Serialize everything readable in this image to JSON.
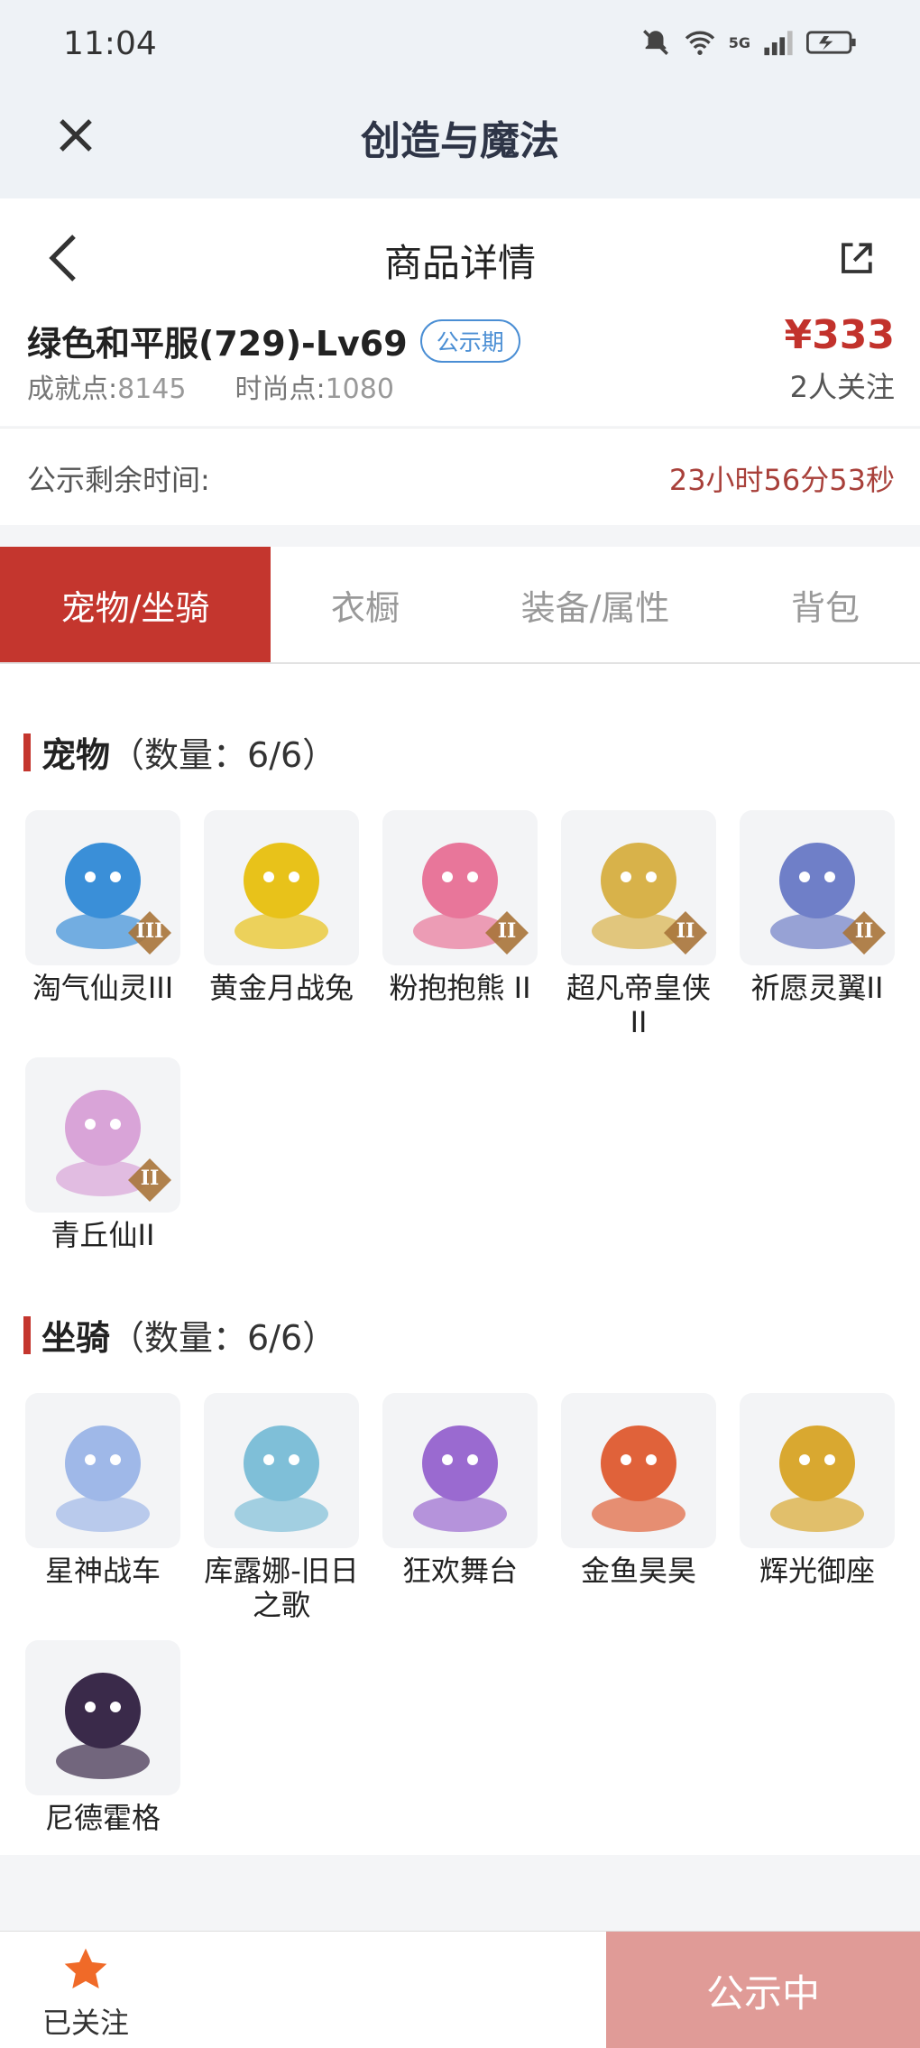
{
  "status_bar": {
    "time": "11:04",
    "signal_label": "5G"
  },
  "app_header": {
    "title": "创造与魔法"
  },
  "page_header": {
    "title": "商品详情"
  },
  "product": {
    "name": "绿色和平服(729)-Lv69",
    "badge": "公示期",
    "achievement_label": "成就点:",
    "achievement_value": "8145",
    "fashion_label": "时尚点:",
    "fashion_value": "1080",
    "price": "¥333",
    "followers": "2人关注"
  },
  "countdown": {
    "label": "公示剩余时间:",
    "value": "23小时56分53秒"
  },
  "tabs": [
    {
      "label": "宠物/坐骑",
      "active": true
    },
    {
      "label": "衣橱",
      "active": false
    },
    {
      "label": "装备/属性",
      "active": false
    },
    {
      "label": "背包",
      "active": false
    }
  ],
  "pets": {
    "title": "宠物",
    "count": "（数量：6/6）",
    "items": [
      {
        "name": "淘气仙灵III",
        "color": "#3a8fd8",
        "rank": "III"
      },
      {
        "name": "黄金月战兔",
        "color": "#e8c21a",
        "rank": ""
      },
      {
        "name": "粉抱抱熊 II",
        "color": "#e8769a",
        "rank": "II"
      },
      {
        "name": "超凡帝皇侠 II",
        "color": "#d8b24a",
        "rank": "II"
      },
      {
        "name": "祈愿灵翼II",
        "color": "#6f7fc8",
        "rank": "II"
      },
      {
        "name": "青丘仙II",
        "color": "#d9a4d8",
        "rank": "II"
      }
    ]
  },
  "mounts": {
    "title": "坐骑",
    "count": "（数量：6/6）",
    "items": [
      {
        "name": "星神战车",
        "color": "#9fb8e8",
        "rank": ""
      },
      {
        "name": "库露娜-旧日之歌",
        "color": "#7fbfd8",
        "rank": ""
      },
      {
        "name": "狂欢舞台",
        "color": "#9a6ad0",
        "rank": ""
      },
      {
        "name": "金鱼昊昊",
        "color": "#e0623a",
        "rank": ""
      },
      {
        "name": "辉光御座",
        "color": "#d9a830",
        "rank": ""
      },
      {
        "name": "尼德霍格",
        "color": "#3a2a4a",
        "rank": ""
      }
    ]
  },
  "bottom_bar": {
    "follow_label": "已关注",
    "status_label": "公示中"
  },
  "colors": {
    "accent": "#c4362e",
    "price": "#c2322c",
    "badge": "#4a8ed4",
    "status_button": "#e09b97"
  }
}
